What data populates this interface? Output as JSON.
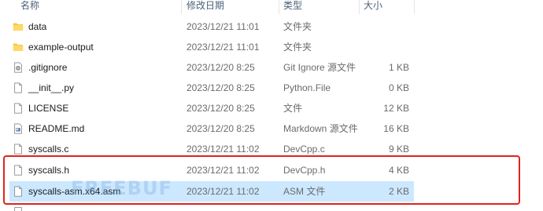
{
  "columns": {
    "name": "名称",
    "date": "修改日期",
    "type": "类型",
    "size": "大小"
  },
  "files": [
    {
      "name": "data",
      "date": "2023/12/21 11:01",
      "type": "文件夹",
      "size": "",
      "icon": "folder-icon"
    },
    {
      "name": "example-output",
      "date": "2023/12/21 11:01",
      "type": "文件夹",
      "size": "",
      "icon": "folder-icon"
    },
    {
      "name": ".gitignore",
      "date": "2023/12/20 8:25",
      "type": "Git Ignore 源文件",
      "size": "1 KB",
      "icon": "settings-file-icon"
    },
    {
      "name": "__init__.py",
      "date": "2023/12/20 8:25",
      "type": "Python.File",
      "size": "0 KB",
      "icon": "file-icon"
    },
    {
      "name": "LICENSE",
      "date": "2023/12/20 8:25",
      "type": "文件",
      "size": "12 KB",
      "icon": "file-icon"
    },
    {
      "name": "README.md",
      "date": "2023/12/20 8:25",
      "type": "Markdown 源文件",
      "size": "16 KB",
      "icon": "markdown-file-icon"
    },
    {
      "name": "syscalls.c",
      "date": "2023/12/21 11:02",
      "type": "DevCpp.c",
      "size": "9 KB",
      "icon": "file-icon"
    },
    {
      "name": "syscalls.h",
      "date": "2023/12/21 11:02",
      "type": "DevCpp.h",
      "size": "4 KB",
      "icon": "file-icon"
    },
    {
      "name": "syscalls-asm.x64.asm",
      "date": "2023/12/21 11:02",
      "type": "ASM 文件",
      "size": "2 KB",
      "icon": "file-icon"
    }
  ],
  "watermark": "FREEBUF",
  "colors": {
    "highlight": "#e0221c",
    "selected_row": "#cce8ff",
    "folder": "#f6c343",
    "header_text": "#4c607a"
  }
}
